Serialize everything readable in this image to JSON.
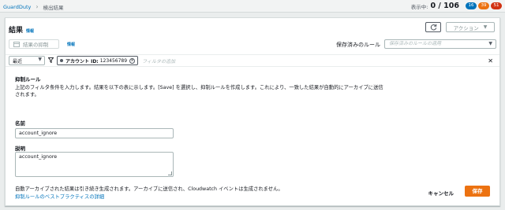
{
  "breadcrumb": {
    "root": "GuardDuty",
    "current": "検出結果"
  },
  "counter": {
    "label": "表示中:",
    "value": "0 / 106",
    "low": "16",
    "medium": "39",
    "high": "51"
  },
  "panel": {
    "title": "結果",
    "info": "情報",
    "action_label": "アクション",
    "suppress_label": "結果の抑制",
    "suppress_info": "情報",
    "saved_rules_label": "保存済みのルール",
    "saved_rules_placeholder": "保存済みのルールの適用"
  },
  "filter": {
    "recent": "最近",
    "token_key": "アカウント ID:",
    "token_value": "123456789",
    "input_placeholder": "フィルタの追加"
  },
  "form": {
    "section_title": "抑制ルール",
    "description": "上記のフィルタ条件を入力します。結果を以下の表に示します。[Save] を選択し、抑制ルールを作成します。これにより、一致した結果が自動的にアーカイブに送信されます。",
    "name_label": "名前",
    "name_value": "account_ignore",
    "desc_label": "説明",
    "desc_value": "account_ignore",
    "note": "自動アーカイブされた結果は引き続き生成されます。アーカイブに送信され、Cloudwatch イベントは生成されません。",
    "best_practice_link": "抑制ルールのベストプラクティスの詳細",
    "cancel": "キャンセル",
    "save": "保存"
  },
  "colors": {
    "accent": "#ec7211",
    "link": "#0073bb",
    "severity_low": "#0073bb",
    "severity_medium": "#ec7211",
    "severity_high": "#d13212"
  }
}
